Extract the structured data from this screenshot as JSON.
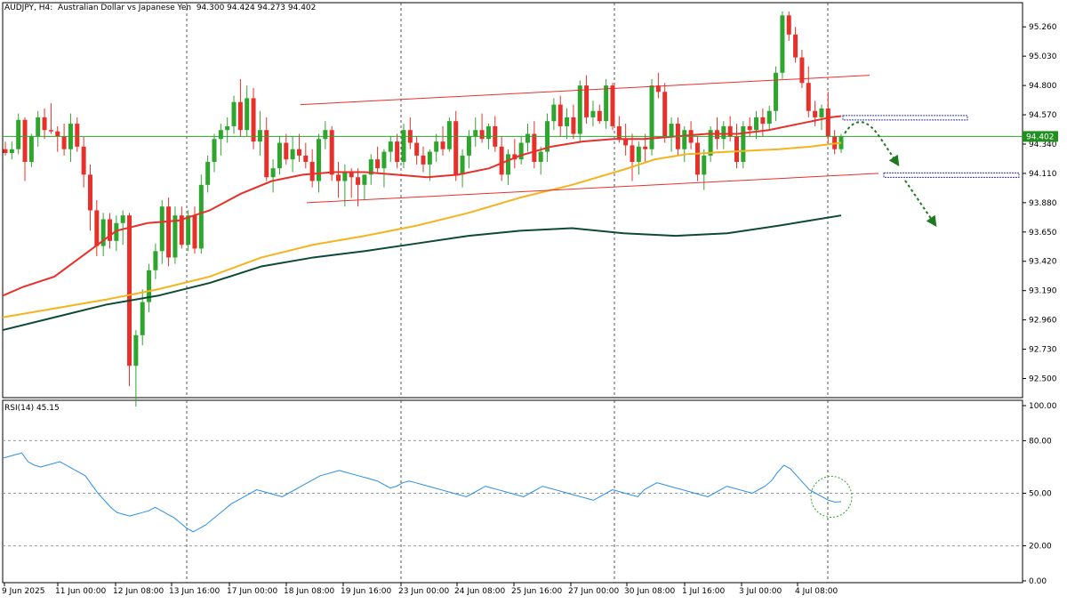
{
  "header": {
    "symbol": "AUDJPY, H4:",
    "description": "Australian Dollar vs Japanese Yen",
    "ohlc": "94.300 94.424 94.273 94.402"
  },
  "rsi_header": {
    "label": "RSI(14) 45.15"
  },
  "current_price_tag": "94.402",
  "colors": {
    "bull": "#2ea62e",
    "bear": "#e8302a",
    "ma_fast": "#e8302a",
    "ma_mid": "#f5b31f",
    "ma_slow": "#0d4a36",
    "channel": "#e8302a",
    "rsi_line": "#2b8ee8",
    "arrow": "#1f7a1f",
    "zone": "#3333cc"
  },
  "chart_data": [
    {
      "type": "candlestick",
      "title": "AUDJPY, H4",
      "ylim": [
        92.35,
        95.45
      ],
      "y_ticks": [
        "95.260",
        "95.030",
        "94.800",
        "94.570",
        "94.340",
        "94.110",
        "93.880",
        "93.650",
        "93.420",
        "93.190",
        "92.960",
        "92.730",
        "92.500"
      ],
      "x_ticks": [
        "9 Jun 2025",
        "11 Jun 00:00",
        "12 Jun 08:00",
        "13 Jun 16:00",
        "17 Jun 00:00",
        "18 Jun 08:00",
        "19 Jun 16:00",
        "23 Jun 00:00",
        "24 Jun 08:00",
        "25 Jun 16:00",
        "27 Jun 00:00",
        "30 Jun 08:00",
        "1 Jul 16:00",
        "3 Jul 00:00",
        "4 Jul 08:00"
      ],
      "candles_ohlc": [
        [
          94.3,
          94.36,
          94.25,
          94.27
        ],
        [
          94.27,
          94.36,
          94.22,
          94.3
        ],
        [
          94.3,
          94.58,
          94.26,
          94.53
        ],
        [
          94.53,
          94.55,
          94.05,
          94.2
        ],
        [
          94.2,
          94.42,
          94.16,
          94.4
        ],
        [
          94.4,
          94.6,
          94.32,
          94.55
        ],
        [
          94.55,
          94.62,
          94.38,
          94.45
        ],
        [
          94.45,
          94.66,
          94.42,
          94.44
        ],
        [
          94.44,
          94.48,
          94.28,
          94.4
        ],
        [
          94.4,
          94.5,
          94.25,
          94.3
        ],
        [
          94.3,
          94.58,
          94.2,
          94.5
        ],
        [
          94.5,
          94.55,
          94.28,
          94.32
        ],
        [
          94.32,
          94.4,
          94.0,
          94.1
        ],
        [
          94.1,
          94.18,
          93.66,
          93.82
        ],
        [
          93.82,
          93.9,
          93.46,
          93.54
        ],
        [
          93.54,
          93.8,
          93.46,
          93.75
        ],
        [
          93.75,
          93.8,
          93.52,
          93.58
        ],
        [
          93.58,
          93.78,
          93.5,
          93.72
        ],
        [
          93.72,
          93.82,
          93.55,
          93.78
        ],
        [
          93.78,
          93.8,
          92.44,
          92.6
        ],
        [
          92.6,
          92.88,
          92.28,
          92.84
        ],
        [
          92.84,
          93.2,
          92.76,
          93.1
        ],
        [
          93.1,
          93.4,
          93.02,
          93.35
        ],
        [
          93.35,
          93.56,
          93.28,
          93.5
        ],
        [
          93.5,
          93.9,
          93.4,
          93.85
        ],
        [
          93.85,
          93.92,
          93.38,
          93.45
        ],
        [
          93.45,
          93.85,
          93.4,
          93.78
        ],
        [
          93.78,
          93.85,
          93.52,
          93.55
        ],
        [
          93.55,
          93.82,
          93.5,
          93.78
        ],
        [
          93.78,
          93.85,
          93.48,
          93.52
        ],
        [
          93.52,
          94.1,
          93.48,
          94.02
        ],
        [
          94.02,
          94.25,
          93.96,
          94.2
        ],
        [
          94.2,
          94.42,
          94.12,
          94.38
        ],
        [
          94.38,
          94.5,
          94.25,
          94.45
        ],
        [
          94.45,
          94.55,
          94.35,
          94.48
        ],
        [
          94.48,
          94.72,
          94.42,
          94.67
        ],
        [
          94.67,
          94.85,
          94.4,
          94.45
        ],
        [
          94.45,
          94.8,
          94.4,
          94.7
        ],
        [
          94.7,
          94.78,
          94.3,
          94.36
        ],
        [
          94.36,
          94.6,
          94.25,
          94.45
        ],
        [
          94.45,
          94.55,
          94.05,
          94.08
        ],
        [
          94.08,
          94.22,
          93.96,
          94.15
        ],
        [
          94.15,
          94.4,
          94.1,
          94.35
        ],
        [
          94.35,
          94.42,
          94.18,
          94.22
        ],
        [
          94.22,
          94.4,
          94.12,
          94.3
        ],
        [
          94.3,
          94.42,
          94.2,
          94.25
        ],
        [
          94.25,
          94.35,
          94.15,
          94.2
        ],
        [
          94.2,
          94.3,
          94.0,
          94.05
        ],
        [
          94.05,
          94.42,
          93.96,
          94.38
        ],
        [
          94.38,
          94.52,
          94.3,
          94.45
        ],
        [
          94.45,
          94.48,
          94.05,
          94.1
        ],
        [
          94.1,
          94.2,
          93.92,
          94.05
        ],
        [
          94.05,
          94.18,
          93.85,
          94.12
        ],
        [
          94.12,
          94.15,
          93.92,
          94.08
        ],
        [
          94.08,
          94.15,
          93.85,
          94.02
        ],
        [
          94.02,
          94.1,
          93.9,
          94.1
        ],
        [
          94.1,
          94.26,
          94.02,
          94.22
        ],
        [
          94.22,
          94.32,
          94.12,
          94.15
        ],
        [
          94.15,
          94.3,
          94.0,
          94.28
        ],
        [
          94.28,
          94.4,
          94.2,
          94.36
        ],
        [
          94.36,
          94.42,
          94.15,
          94.2
        ],
        [
          94.2,
          94.5,
          94.15,
          94.45
        ],
        [
          94.45,
          94.55,
          94.3,
          94.35
        ],
        [
          94.35,
          94.4,
          94.18,
          94.25
        ],
        [
          94.25,
          94.32,
          94.12,
          94.18
        ],
        [
          94.18,
          94.3,
          94.05,
          94.28
        ],
        [
          94.28,
          94.42,
          94.2,
          94.36
        ],
        [
          94.36,
          94.48,
          94.25,
          94.3
        ],
        [
          94.3,
          94.55,
          94.28,
          94.52
        ],
        [
          94.52,
          94.6,
          94.05,
          94.1
        ],
        [
          94.1,
          94.3,
          94.0,
          94.25
        ],
        [
          94.25,
          94.45,
          94.15,
          94.4
        ],
        [
          94.4,
          94.55,
          94.32,
          94.45
        ],
        [
          94.45,
          94.58,
          94.35,
          94.38
        ],
        [
          94.38,
          94.5,
          94.3,
          94.48
        ],
        [
          94.48,
          94.56,
          94.28,
          94.32
        ],
        [
          94.32,
          94.4,
          94.05,
          94.1
        ],
        [
          94.1,
          94.3,
          94.02,
          94.26
        ],
        [
          94.26,
          94.38,
          94.15,
          94.22
        ],
        [
          94.22,
          94.4,
          94.18,
          94.35
        ],
        [
          94.35,
          94.5,
          94.28,
          94.42
        ],
        [
          94.42,
          94.52,
          94.15,
          94.2
        ],
        [
          94.2,
          94.32,
          94.1,
          94.28
        ],
        [
          94.28,
          94.58,
          94.2,
          94.52
        ],
        [
          94.52,
          94.7,
          94.45,
          94.65
        ],
        [
          94.65,
          94.72,
          94.4,
          94.48
        ],
        [
          94.48,
          94.62,
          94.38,
          94.55
        ],
        [
          94.55,
          94.65,
          94.38,
          94.42
        ],
        [
          94.42,
          94.84,
          94.36,
          94.8
        ],
        [
          94.8,
          94.88,
          94.5,
          94.55
        ],
        [
          94.55,
          94.68,
          94.48,
          94.6
        ],
        [
          94.6,
          94.65,
          94.5,
          94.52
        ],
        [
          94.52,
          94.85,
          94.46,
          94.8
        ],
        [
          94.8,
          94.82,
          94.45,
          94.48
        ],
        [
          94.48,
          94.56,
          94.35,
          94.38
        ],
        [
          94.38,
          94.5,
          94.25,
          94.33
        ],
        [
          94.33,
          94.42,
          94.05,
          94.2
        ],
        [
          94.2,
          94.36,
          94.1,
          94.32
        ],
        [
          94.32,
          94.42,
          94.2,
          94.3
        ],
        [
          94.3,
          94.85,
          94.25,
          94.8
        ],
        [
          94.8,
          94.9,
          94.7,
          94.75
        ],
        [
          94.75,
          94.82,
          94.35,
          94.4
        ],
        [
          94.4,
          94.55,
          94.28,
          94.5
        ],
        [
          94.5,
          94.55,
          94.25,
          94.3
        ],
        [
          94.3,
          94.48,
          94.2,
          94.45
        ],
        [
          94.45,
          94.52,
          94.3,
          94.35
        ],
        [
          94.35,
          94.4,
          94.05,
          94.1
        ],
        [
          94.1,
          94.3,
          93.98,
          94.25
        ],
        [
          94.25,
          94.48,
          94.2,
          94.45
        ],
        [
          94.45,
          94.55,
          94.3,
          94.38
        ],
        [
          94.38,
          94.52,
          94.3,
          94.48
        ],
        [
          94.48,
          94.56,
          94.36,
          94.4
        ],
        [
          94.4,
          94.5,
          94.15,
          94.2
        ],
        [
          94.2,
          94.52,
          94.15,
          94.48
        ],
        [
          94.48,
          94.55,
          94.4,
          94.45
        ],
        [
          94.45,
          94.6,
          94.38,
          94.55
        ],
        [
          94.55,
          94.62,
          94.4,
          94.5
        ],
        [
          94.5,
          94.64,
          94.45,
          94.6
        ],
        [
          94.6,
          94.95,
          94.52,
          94.9
        ],
        [
          94.9,
          95.38,
          94.85,
          95.35
        ],
        [
          95.35,
          95.38,
          95.15,
          95.2
        ],
        [
          95.2,
          95.26,
          94.98,
          95.02
        ],
        [
          95.02,
          95.08,
          94.78,
          94.82
        ],
        [
          94.82,
          94.95,
          94.55,
          94.6
        ],
        [
          94.6,
          94.68,
          94.48,
          94.55
        ],
        [
          94.55,
          94.65,
          94.45,
          94.62
        ],
        [
          94.62,
          94.75,
          94.35,
          94.4
        ],
        [
          94.4,
          94.45,
          94.26,
          94.3
        ],
        [
          94.3,
          94.42,
          94.27,
          94.4
        ]
      ],
      "moving_averages": [
        {
          "color_key": "ma_fast",
          "points": [
            [
              0,
              93.15
            ],
            [
              0.02,
              93.22
            ],
            [
              0.05,
              93.3
            ],
            [
              0.08,
              93.48
            ],
            [
              0.11,
              93.66
            ],
            [
              0.14,
              93.72
            ],
            [
              0.17,
              93.74
            ],
            [
              0.2,
              93.82
            ],
            [
              0.23,
              93.95
            ],
            [
              0.26,
              94.05
            ],
            [
              0.29,
              94.1
            ],
            [
              0.32,
              94.12
            ],
            [
              0.35,
              94.12
            ],
            [
              0.38,
              94.1
            ],
            [
              0.41,
              94.08
            ],
            [
              0.44,
              94.1
            ],
            [
              0.47,
              94.15
            ],
            [
              0.5,
              94.25
            ],
            [
              0.53,
              94.32
            ],
            [
              0.56,
              94.36
            ],
            [
              0.59,
              94.38
            ],
            [
              0.62,
              94.38
            ],
            [
              0.65,
              94.4
            ],
            [
              0.68,
              94.42
            ],
            [
              0.71,
              94.42
            ],
            [
              0.74,
              94.45
            ],
            [
              0.77,
              94.5
            ],
            [
              0.8,
              94.55
            ],
            [
              0.81,
              94.56
            ]
          ]
        },
        {
          "color_key": "ma_mid",
          "points": [
            [
              0,
              92.98
            ],
            [
              0.05,
              93.05
            ],
            [
              0.1,
              93.12
            ],
            [
              0.15,
              93.2
            ],
            [
              0.2,
              93.3
            ],
            [
              0.25,
              93.45
            ],
            [
              0.3,
              93.55
            ],
            [
              0.35,
              93.62
            ],
            [
              0.4,
              93.7
            ],
            [
              0.45,
              93.8
            ],
            [
              0.5,
              93.92
            ],
            [
              0.55,
              94.02
            ],
            [
              0.6,
              94.14
            ],
            [
              0.63,
              94.22
            ],
            [
              0.66,
              94.26
            ],
            [
              0.7,
              94.28
            ],
            [
              0.75,
              94.3
            ],
            [
              0.78,
              94.32
            ],
            [
              0.81,
              94.35
            ]
          ]
        },
        {
          "color_key": "ma_slow",
          "points": [
            [
              0,
              92.88
            ],
            [
              0.05,
              92.98
            ],
            [
              0.1,
              93.08
            ],
            [
              0.15,
              93.15
            ],
            [
              0.2,
              93.25
            ],
            [
              0.25,
              93.38
            ],
            [
              0.3,
              93.45
            ],
            [
              0.35,
              93.5
            ],
            [
              0.4,
              93.56
            ],
            [
              0.45,
              93.62
            ],
            [
              0.5,
              93.66
            ],
            [
              0.55,
              93.68
            ],
            [
              0.6,
              93.64
            ],
            [
              0.65,
              93.62
            ],
            [
              0.7,
              93.64
            ],
            [
              0.75,
              93.7
            ],
            [
              0.78,
              93.74
            ],
            [
              0.81,
              93.78
            ]
          ]
        }
      ],
      "trend_channel": {
        "upper": [
          94.65,
          94.88
        ],
        "lower": [
          93.88,
          94.11
        ]
      },
      "zones": [
        94.55,
        94.1
      ]
    },
    {
      "type": "line",
      "title": "RSI(14) 45.15",
      "ylim": [
        0,
        100
      ],
      "y_ticks": [
        "100.00",
        "80.00",
        "50.00",
        "20.00",
        "0.00"
      ],
      "levels": [
        80,
        50,
        20
      ],
      "values": [
        70,
        71,
        72,
        73,
        68,
        66,
        65,
        66,
        67,
        68,
        66,
        64,
        62,
        60,
        55,
        50,
        46,
        42,
        39,
        38,
        37,
        38,
        39,
        40,
        42,
        40,
        38,
        36,
        33,
        30,
        28,
        30,
        32,
        35,
        38,
        41,
        44,
        46,
        48,
        50,
        52,
        51,
        50,
        49,
        48,
        50,
        52,
        54,
        56,
        58,
        60,
        61,
        62,
        63,
        62,
        61,
        60,
        59,
        58,
        57,
        55,
        53,
        54,
        56,
        57,
        56,
        55,
        54,
        53,
        52,
        51,
        50,
        49,
        48,
        50,
        52,
        54,
        53,
        52,
        51,
        50,
        49,
        48,
        50,
        52,
        54,
        53,
        52,
        51,
        50,
        49,
        48,
        47,
        46,
        48,
        50,
        52,
        51,
        50,
        49,
        48,
        52,
        54,
        56,
        55,
        54,
        53,
        52,
        51,
        50,
        49,
        48,
        50,
        52,
        54,
        53,
        52,
        51,
        50,
        52,
        54,
        57,
        62,
        66,
        64,
        60,
        56,
        52,
        50,
        48,
        46,
        45,
        45.15
      ]
    }
  ]
}
